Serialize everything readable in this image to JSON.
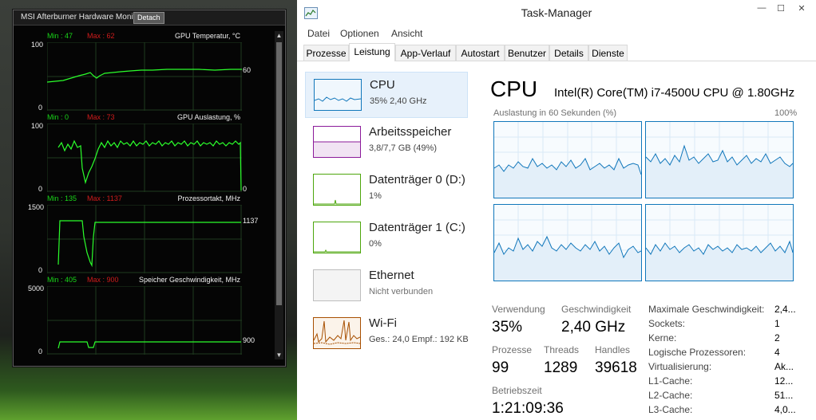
{
  "msi": {
    "title": "MSI Afterburner Hardware Monitor",
    "detach_label": "Detach",
    "scroll_up": "▲",
    "scroll_down": "▼",
    "graphs": [
      {
        "min": "Min : 47",
        "max": "Max : 62",
        "title": "GPU Temperatur, °C",
        "top_axis": "100",
        "bottom_axis": "0",
        "current": "60"
      },
      {
        "min": "Min : 0",
        "max": "Max : 73",
        "title": "GPU Auslastung, %",
        "top_axis": "100",
        "bottom_axis": "0",
        "current": "0"
      },
      {
        "min": "Min : 135",
        "max": "Max : 1137",
        "title": "Prozessortakt, MHz",
        "top_axis": "1500",
        "bottom_axis": "0",
        "current": "1137"
      },
      {
        "min": "Min : 405",
        "max": "Max : 900",
        "title": "Speicher Geschwindigkeit, MHz",
        "top_axis": "5000",
        "bottom_axis": "0",
        "current": "900"
      }
    ]
  },
  "taskmanager": {
    "title": "Task-Manager",
    "win_minimize": "—",
    "win_maximize": "☐",
    "win_close": "✕",
    "menu": [
      "Datei",
      "Optionen",
      "Ansicht"
    ],
    "tabs": [
      "Prozesse",
      "Leistung",
      "App-Verlauf",
      "Autostart",
      "Benutzer",
      "Details",
      "Dienste"
    ],
    "active_tab": "Leistung",
    "perf_items": [
      {
        "name": "CPU",
        "sub": "35% 2,40 GHz",
        "color": "#1177bb"
      },
      {
        "name": "Arbeitsspeicher",
        "sub": "3,8/7,7 GB (49%)",
        "color": "#8b1a9a"
      },
      {
        "name": "Datenträger 0 (D:)",
        "sub": "1%",
        "color": "#4da60c"
      },
      {
        "name": "Datenträger 1 (C:)",
        "sub": "0%",
        "color": "#4da60c"
      },
      {
        "name": "Ethernet",
        "sub": "Nicht verbunden",
        "color": "#a0a0a0"
      },
      {
        "name": "Wi-Fi",
        "sub": "Ges.: 24,0 Empf.: 192 KB",
        "color": "#a74f01"
      }
    ],
    "detail": {
      "heading": "CPU",
      "model": "Intel(R) Core(TM) i7-4500U CPU @ 1.80GHz",
      "chart_label": "Auslastung in 60 Sekunden (%)",
      "chart_max": "100%",
      "stats": {
        "verwendung_label": "Verwendung",
        "verwendung": "35%",
        "geschw_label": "Geschwindigkeit",
        "geschw": "2,40 GHz",
        "prozesse_label": "Prozesse",
        "prozesse": "99",
        "threads_label": "Threads",
        "threads": "1289",
        "handles_label": "Handles",
        "handles": "39618",
        "betrieb_label": "Betriebszeit",
        "betrieb": "1:21:09:36"
      },
      "specs": [
        {
          "label": "Maximale Geschwindigkeit:",
          "value": "2,4..."
        },
        {
          "label": "Sockets:",
          "value": "1"
        },
        {
          "label": "Kerne:",
          "value": "2"
        },
        {
          "label": "Logische Prozessoren:",
          "value": "4"
        },
        {
          "label": "Virtualisierung:",
          "value": "Ak..."
        },
        {
          "label": "L1-Cache:",
          "value": "12..."
        },
        {
          "label": "L2-Cache:",
          "value": "51..."
        },
        {
          "label": "L3-Cache:",
          "value": "4,0..."
        }
      ]
    }
  }
}
